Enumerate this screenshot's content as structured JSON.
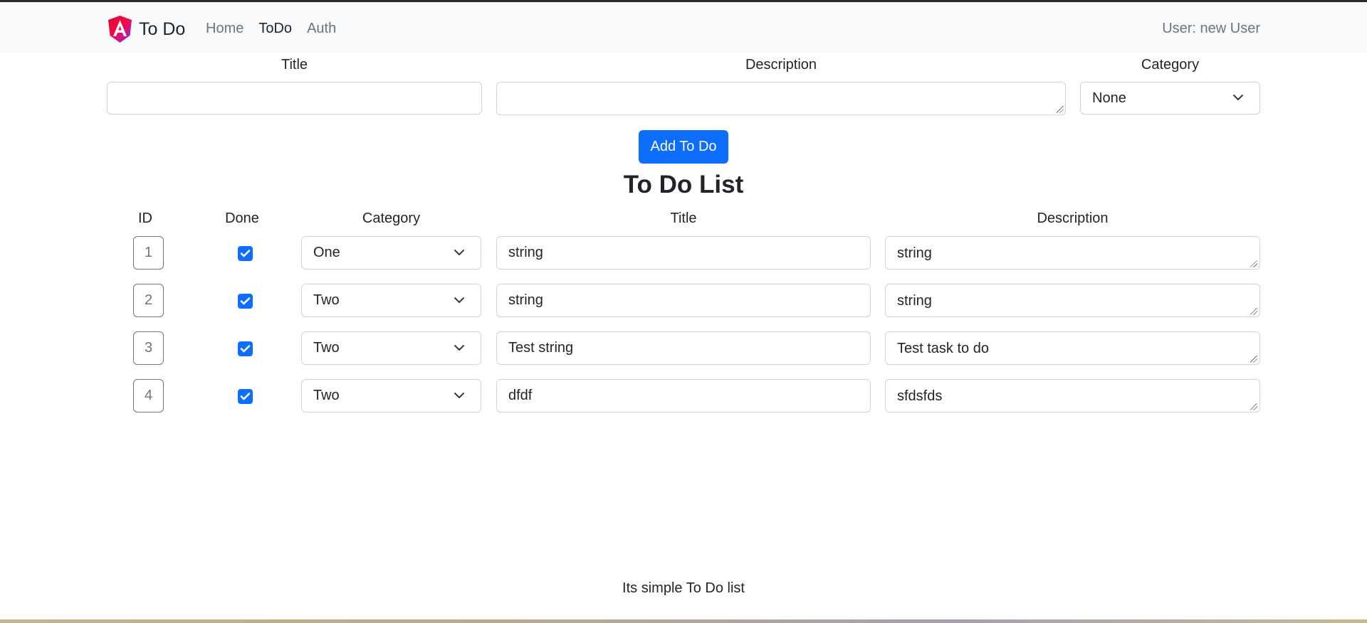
{
  "navbar": {
    "brand": "To Do",
    "links": [
      "Home",
      "ToDo",
      "Auth"
    ],
    "active_link": "ToDo",
    "user_label": "User: new User"
  },
  "form": {
    "title_label": "Title",
    "description_label": "Description",
    "category_label": "Category",
    "title_value": "",
    "description_value": "",
    "category_value": "None",
    "add_button": "Add To Do"
  },
  "list": {
    "heading": "To Do List",
    "headers": {
      "id": "ID",
      "done": "Done",
      "category": "Category",
      "title": "Title",
      "description": "Description"
    },
    "rows": [
      {
        "id": "1",
        "done": true,
        "category": "One",
        "title": "string",
        "description": "string"
      },
      {
        "id": "2",
        "done": true,
        "category": "Two",
        "title": "string",
        "description": "string"
      },
      {
        "id": "3",
        "done": true,
        "category": "Two",
        "title": "Test string",
        "description": "Test task to do"
      },
      {
        "id": "4",
        "done": true,
        "category": "Two",
        "title": "dfdf",
        "description": "sfdsfds"
      }
    ]
  },
  "footer": {
    "text": "Its simple To Do list"
  },
  "colors": {
    "primary": "#0d6efd",
    "navbar_bg": "#f8f9fa",
    "text": "#212529",
    "muted": "#6c757d",
    "border": "#ced4da"
  }
}
